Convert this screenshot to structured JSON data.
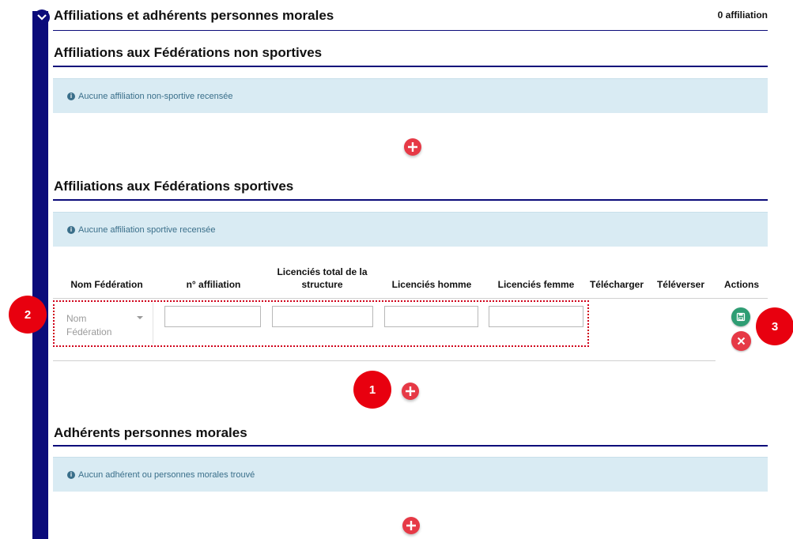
{
  "header": {
    "title": "Affiliations et adhérents personnes morales",
    "count": "0 affiliation"
  },
  "sections": {
    "non_sportives": {
      "title": "Affiliations aux Fédérations non sportives",
      "empty_message": "Aucune affiliation non-sportive recensée"
    },
    "sportives": {
      "title": "Affiliations aux Fédérations sportives",
      "empty_message": "Aucune affiliation sportive recensée"
    },
    "adherents": {
      "title": "Adhérents personnes morales",
      "empty_message": "Aucun adhérent ou personnes morales trouvé"
    }
  },
  "table": {
    "columns": [
      "Nom Fédération",
      "n° affiliation",
      "Licenciés total de la structure",
      "Licenciés homme",
      "Licenciés femme",
      "Télécharger",
      "Téléverser",
      "Actions"
    ],
    "row": {
      "federation_placeholder": "Nom Fédération",
      "affiliation": "",
      "total": "",
      "homme": "",
      "femme": ""
    }
  },
  "callouts": {
    "one": "1",
    "two": "2",
    "three": "3"
  },
  "icons": {
    "toggle": "chevron-down-icon",
    "info": "info-circle-icon",
    "add": "plus-circle-icon",
    "save": "save-icon",
    "cancel": "close-icon"
  },
  "colors": {
    "accent": "#0b0b7a",
    "info_bg": "#d9ebf3",
    "danger": "#e63946",
    "success": "#2e9d73",
    "callout": "#e8000f"
  }
}
